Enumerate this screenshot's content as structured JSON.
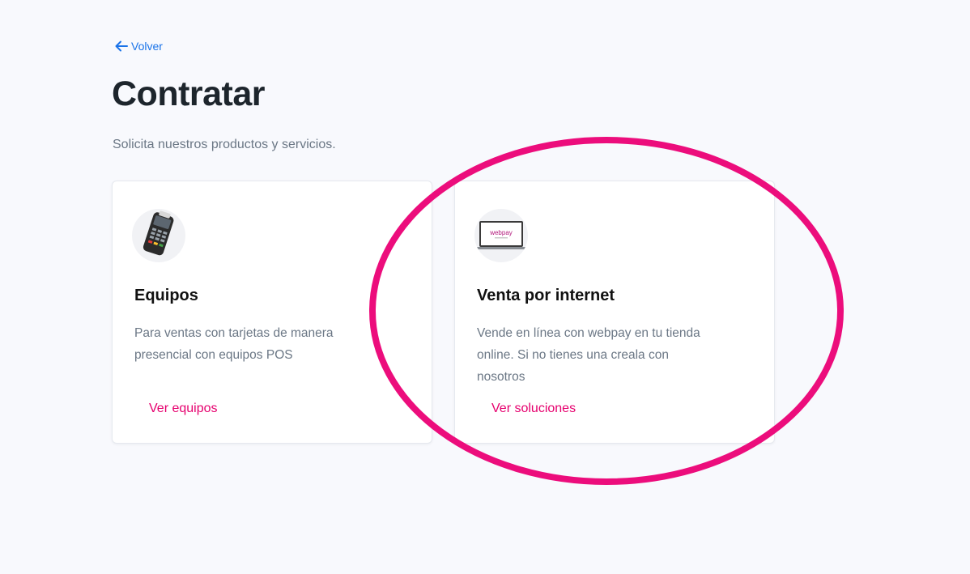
{
  "nav": {
    "back_label": "Volver"
  },
  "page": {
    "title": "Contratar",
    "subtitle": "Solicita nuestros productos y servicios."
  },
  "cards": [
    {
      "icon": "pos-terminal-icon",
      "title": "Equipos",
      "description": "Para ventas con tarjetas de manera presencial con equipos POS",
      "link": "Ver equipos"
    },
    {
      "icon": "laptop-webpay-icon",
      "logo_text": "webpay",
      "title": "Venta por internet",
      "description": "Vende en línea con webpay en tu tienda online. Si no tienes una creala con nosotros",
      "link": "Ver soluciones"
    }
  ],
  "colors": {
    "background": "#f8f9fd",
    "link_blue": "#1a73e8",
    "accent_pink": "#e6006e",
    "highlight_ellipse": "#ec0d7c"
  }
}
